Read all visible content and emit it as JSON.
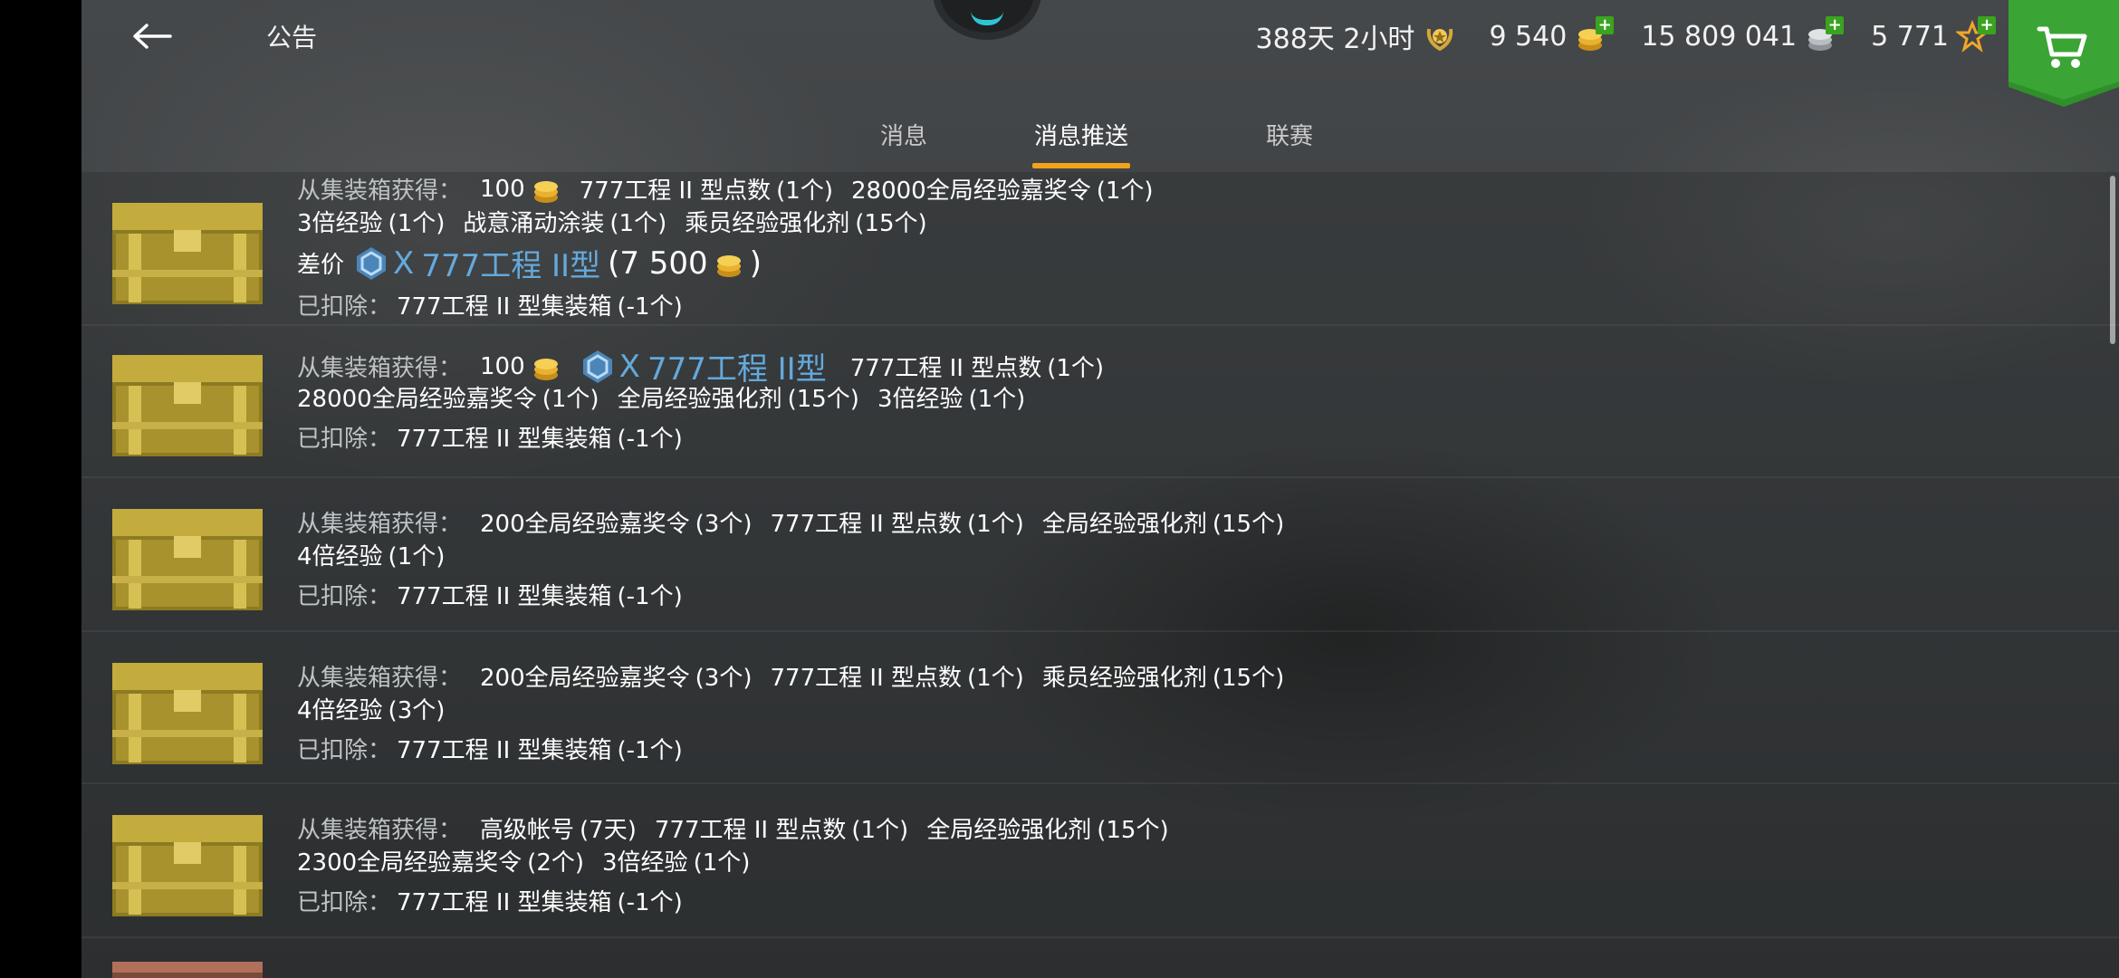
{
  "header": {
    "title": "公告",
    "stats": [
      {
        "value": "388天 2小时",
        "icon": "premium-laurel-icon"
      },
      {
        "value": "9 540",
        "icon": "gold-coins-icon"
      },
      {
        "value": "15 809 041",
        "icon": "silver-credits-icon"
      },
      {
        "value": "5 771",
        "icon": "free-xp-star-icon"
      }
    ]
  },
  "tabs": [
    {
      "label": "消息",
      "active": false
    },
    {
      "label": "消息推送",
      "active": true
    },
    {
      "label": "联赛",
      "active": false
    }
  ],
  "messages": [
    {
      "line1": {
        "label": "从集装箱获得：",
        "gold": "100",
        "item1": "777工程 II 型点数",
        "cnt1": "(1个)",
        "item2": "28000全局经验嘉奖令",
        "cnt2": "(1个)"
      },
      "line2": {
        "item1": "3倍经验",
        "cnt1": "(1个)",
        "item2": "战意涌动涂装",
        "cnt2": "(1个)",
        "item3": "乘员经验强化剂",
        "cnt3": "(15个)"
      },
      "line3": {
        "label": "差价",
        "tier": "X",
        "tank": "777工程 II型",
        "price_open": "(7 500",
        "price_close": ")"
      },
      "line4": {
        "label": "已扣除：",
        "item": "777工程 II 型集装箱",
        "cnt": "(-1个)"
      }
    },
    {
      "line1": {
        "label": "从集装箱获得：",
        "gold": "100",
        "tier": "X",
        "tank": "777工程 II型",
        "item1": "777工程 II 型点数",
        "cnt1": "(1个)"
      },
      "line2": {
        "item1": "28000全局经验嘉奖令",
        "cnt1": "(1个)",
        "item2": "全局经验强化剂",
        "cnt2": "(15个)",
        "item3": "3倍经验",
        "cnt3": "(1个)"
      },
      "line3": {
        "label": "已扣除：",
        "item": "777工程 II 型集装箱",
        "cnt": "(-1个)"
      }
    },
    {
      "line1": {
        "label": "从集装箱获得：",
        "item1": "200全局经验嘉奖令",
        "cnt1": "(3个)",
        "item2": "777工程 II 型点数",
        "cnt2": "(1个)",
        "item3": "全局经验强化剂",
        "cnt3": "(15个)"
      },
      "line2": {
        "item1": "4倍经验",
        "cnt1": "(1个)"
      },
      "line3": {
        "label": "已扣除：",
        "item": "777工程 II 型集装箱",
        "cnt": "(-1个)"
      }
    },
    {
      "line1": {
        "label": "从集装箱获得：",
        "item1": "200全局经验嘉奖令",
        "cnt1": "(3个)",
        "item2": "777工程 II 型点数",
        "cnt2": "(1个)",
        "item3": "乘员经验强化剂",
        "cnt3": "(15个)"
      },
      "line2": {
        "item1": "4倍经验",
        "cnt1": "(3个)"
      },
      "line3": {
        "label": "已扣除：",
        "item": "777工程 II 型集装箱",
        "cnt": "(-1个)"
      }
    },
    {
      "line1": {
        "label": "从集装箱获得：",
        "item1": "高级帐号",
        "cnt1": "(7天)",
        "item2": "777工程 II 型点数",
        "cnt2": "(1个)",
        "item3": "全局经验强化剂",
        "cnt3": "(15个)"
      },
      "line2": {
        "item1": "2300全局经验嘉奖令",
        "cnt1": "(2个)",
        "item2": "3倍经验",
        "cnt2": "(1个)"
      },
      "line3": {
        "label": "已扣除：",
        "item": "777工程 II 型集装箱",
        "cnt": "(-1个)"
      }
    }
  ],
  "colors": {
    "accent_tab": "#f2a21b",
    "orange_item": "#e0a640",
    "purple_item": "#c152e6",
    "blue_item": "#5f7de0",
    "grey_item": "#9aa3ab",
    "tank_name": "#64a9dc",
    "plus_green": "#3aa320"
  }
}
